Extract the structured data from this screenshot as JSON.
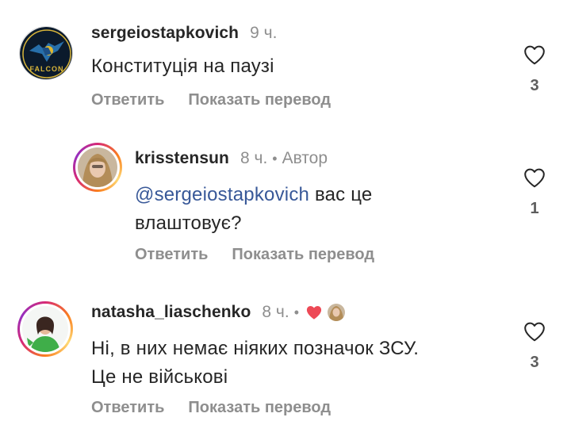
{
  "comments": [
    {
      "username": "sergeiostapkovich",
      "time": "9 ч.",
      "text": "Конституція на паузі",
      "reply_label": "Ответить",
      "translate_label": "Показать перевод",
      "likes": "3",
      "avatar_text": "FALCON"
    },
    {
      "username": "krisstensun",
      "time": "8 ч.",
      "dot": "•",
      "author_tag": "Автор",
      "mention": "@sergeiostapkovich",
      "text_after_mention": " вас це",
      "text_line2": "влаштовує?",
      "reply_label": "Ответить",
      "translate_label": "Показать перевод",
      "likes": "1"
    },
    {
      "username": "natasha_liaschenko",
      "time": "8 ч.",
      "dot": "•",
      "text_line1": "Ні, в них немає ніяких позначок ЗСУ.",
      "text_line2": "Це не військові",
      "reply_label": "Ответить",
      "translate_label": "Показать перевод",
      "likes": "3"
    }
  ],
  "icons": {
    "like": "heart-outline-icon",
    "author_like": "heart-filled-icon"
  },
  "colors": {
    "username": "#262626",
    "meta": "#8e8e8e",
    "mention": "#385898",
    "heart_red": "#ed4956"
  }
}
